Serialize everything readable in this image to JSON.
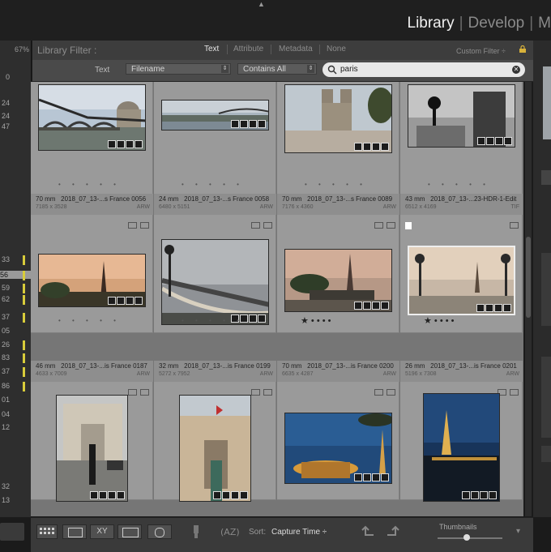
{
  "top": {
    "modules": [
      "Library",
      "Develop",
      "M"
    ],
    "active_module": "Library"
  },
  "left_panel": {
    "header": "67%",
    "numbers": [
      "0",
      "24",
      "24",
      "47",
      "33",
      "56",
      "59",
      "62",
      "37",
      "05",
      "26",
      "83",
      "37",
      "86",
      "01",
      "04",
      "12",
      "32",
      "13"
    ],
    "selected_value": "56"
  },
  "filter": {
    "title": "Library Filter :",
    "tabs": [
      "Text",
      "Attribute",
      "Metadata",
      "None"
    ],
    "active_tab": "Text",
    "custom_filter": "Custom Filter ÷",
    "text_label": "Text",
    "field_select": "Filename",
    "rule_select": "Contains All",
    "search_value": "paris"
  },
  "grid": {
    "row1": [
      {
        "rating_dots": "• • • • •"
      },
      {
        "rating_dots": "• • • • •"
      },
      {
        "rating_dots": "• • • • •"
      },
      {
        "rating_dots": "• • • • •"
      }
    ],
    "row2": [
      {
        "focal": "70 mm",
        "name": "2018_07_13-...s France 0056",
        "dims": "7185 x 3528",
        "ext": "ARW",
        "rating": "• • • • •"
      },
      {
        "focal": "24 mm",
        "name": "2018_07_13-...s France 0058",
        "dims": "6480 x 5151",
        "ext": "ARW",
        "rating": "• • • • •"
      },
      {
        "focal": "70 mm",
        "name": "2018_07_13-...s France 0089",
        "dims": "7176 x 4360",
        "ext": "ARW",
        "rating": "★ • • • •"
      },
      {
        "focal": "43 mm",
        "name": "2018_07_13-...23-HDR-1-Edit",
        "dims": "6512 x 4169",
        "ext": "TIF",
        "rating": "★ • • • •"
      }
    ],
    "row3": [
      {
        "focal": "46 mm",
        "name": "2018_07_13-...is France 0187",
        "dims": "4633 x 7009",
        "ext": "ARW"
      },
      {
        "focal": "32 mm",
        "name": "2018_07_13-...is France 0199",
        "dims": "5272 x 7952",
        "ext": "ARW"
      },
      {
        "focal": "70 mm",
        "name": "2018_07_13-...is France 0200",
        "dims": "6635 x 4287",
        "ext": "ARW"
      },
      {
        "focal": "26 mm",
        "name": "2018_07_13-...is France 0201",
        "dims": "5196 x 7308",
        "ext": "ARW"
      }
    ]
  },
  "toolbar": {
    "sort_label": "Sort:",
    "sort_value": "Capture Time ÷",
    "thumbnails_label": "Thumbnails",
    "thumbnail_size": 0.45
  },
  "colors": {
    "accent_mark": "#d8cc3a",
    "grid_bg": "#9a9a9a"
  }
}
